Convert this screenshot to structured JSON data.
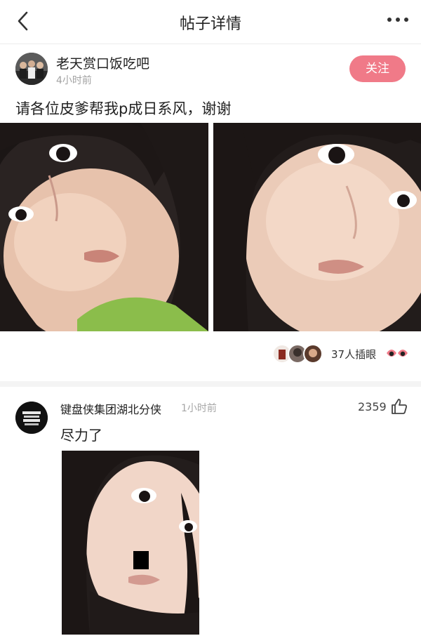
{
  "header": {
    "title": "帖子详情"
  },
  "post": {
    "author": "老天赏口饭吃吧",
    "time": "4小时前",
    "follow_label": "关注",
    "text": "请各位皮爹帮我p成日系风，谢谢",
    "reaction_count_text": "37人插眼"
  },
  "comment": {
    "author": "键盘侠集团湖北分侠",
    "time": "1小时前",
    "likes": "2359",
    "text": "尽力了"
  },
  "colors": {
    "accent": "#f07a88",
    "muted": "#a2a2a2"
  },
  "icons": [
    "back-arrow-icon",
    "more-icon",
    "eyes-icon",
    "thumbs-up-icon"
  ]
}
